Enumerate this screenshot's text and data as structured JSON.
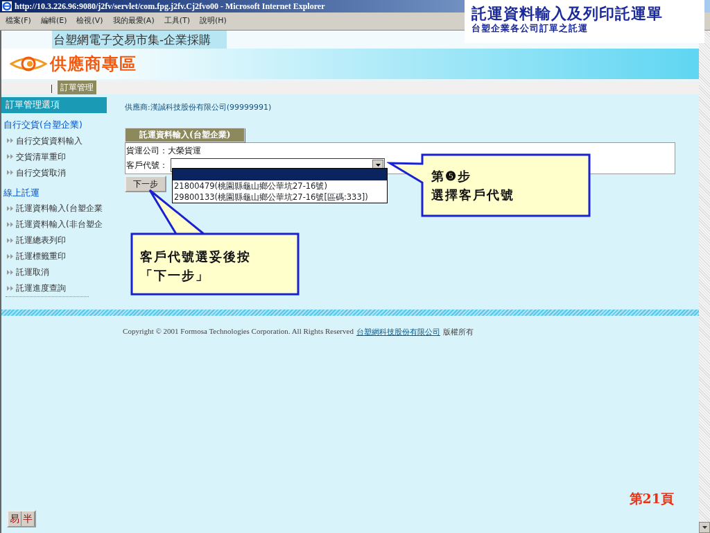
{
  "window": {
    "title": "http://10.3.226.96:9080/j2fv/servlet/com.fpg.j2fv.Cj2fvo00 - Microsoft Internet Explorer"
  },
  "menu": [
    "檔案(F)",
    "編輯(E)",
    "檢視(V)",
    "我的最愛(A)",
    "工具(T)",
    "說明(H)"
  ],
  "annotation": {
    "title": "託運資料輸入及列印託運單",
    "subtitle": "台塑企業各公司訂單之託運"
  },
  "header": {
    "market": "台塑網電子交易市集-企業採購",
    "zone": "供應商專區"
  },
  "tabs": [
    {
      "label": "訂單管理",
      "selected": true
    }
  ],
  "sidebar": {
    "title": "訂單管理選項",
    "sections": [
      {
        "label": "自行交貨(台塑企業)",
        "items": [
          "自行交貨資料輸入",
          "交貨清單重印",
          "自行交貨取消"
        ]
      },
      {
        "label": "線上託運",
        "items": [
          "託運資料輸入(台塑企業",
          "託運資料輸入(非台塑企",
          "託運總表列印",
          "託運標籤重印",
          "託運取消",
          "託運進度查詢"
        ]
      }
    ]
  },
  "supplier": "供應商:漢誠科技股份有限公司(99999991)",
  "form": {
    "title": "託運資料輸入(台塑企業)",
    "carrier_label": "貨運公司：",
    "carrier": "大榮貨運",
    "customer_label": "客戶代號：",
    "dropdown_expanded": true,
    "options": [
      {
        "label": "21800479(桃園縣龜山鄉公華坑27-16號)",
        "selected": false
      },
      {
        "label": "29800133(桃園縣龜山鄉公華坑27-16號[區碼:333])",
        "selected": false
      }
    ],
    "next_button": "下一步"
  },
  "callouts": [
    {
      "lines": [
        "第❺步",
        "選擇客戶代號"
      ]
    },
    {
      "lines": [
        "客戶代號選妥後按",
        "「下一步」"
      ]
    }
  ],
  "footer": {
    "copyright": "Copyright © 2001 Formosa Technologies Corporation. All Rights Reserved",
    "company": "台塑網科技股份有限公司",
    "rights": "版權所有"
  },
  "page_number": "第21頁",
  "ime_buttons": [
    "易",
    "半"
  ]
}
